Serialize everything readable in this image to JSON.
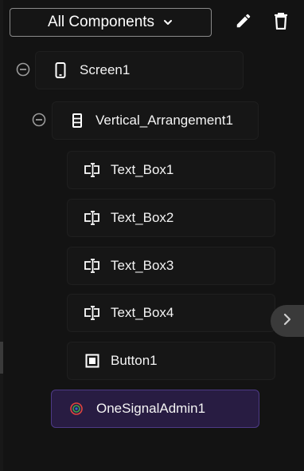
{
  "filter": {
    "label": "All Components",
    "chevron_icon": "chevron-down-icon"
  },
  "toolbar": {
    "edit_icon": "pencil-icon",
    "delete_icon": "trash-icon"
  },
  "tree": {
    "screen": {
      "label": "Screen1",
      "icon": "phone-icon"
    },
    "arrangement": {
      "label": "Vertical_Arrangement1",
      "icon": "vertical-arrangement-icon"
    },
    "textboxes": [
      {
        "label": "Text_Box1",
        "icon": "textbox-icon"
      },
      {
        "label": "Text_Box2",
        "icon": "textbox-icon"
      },
      {
        "label": "Text_Box3",
        "icon": "textbox-icon"
      },
      {
        "label": "Text_Box4",
        "icon": "textbox-icon"
      }
    ],
    "button": {
      "label": "Button1",
      "icon": "button-icon"
    },
    "extension": {
      "label": "OneSignalAdmin1",
      "icon": "onesignal-icon",
      "selected": true
    }
  },
  "colors": {
    "selected_bg": "#281c42",
    "selected_border": "#4d3a86",
    "accent_red": "#e0453f"
  }
}
